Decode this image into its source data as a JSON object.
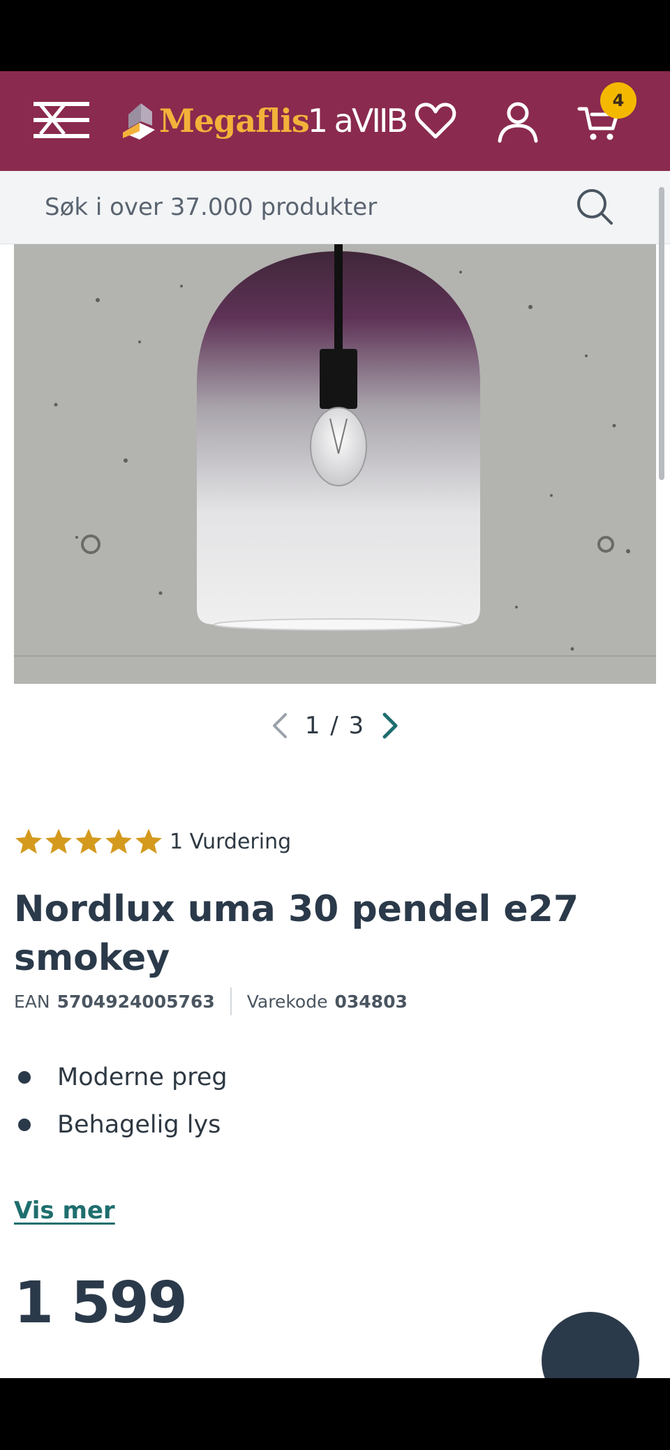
{
  "header": {
    "logo_text": "Megaflis",
    "logo_suffix": "1 aVIIB",
    "cart_count": "4"
  },
  "search": {
    "placeholder": "Søk i over 37.000 produkter"
  },
  "gallery": {
    "pager_text": "1 / 3"
  },
  "product": {
    "rating_text": "1 Vurdering",
    "stars": 5,
    "title": "Nordlux uma 30 pendel e27 smokey",
    "ean_label": "EAN",
    "ean_value": "5704924005763",
    "code_label": "Varekode",
    "code_value": "034803",
    "bullets": [
      "Moderne preg",
      "Behagelig lys"
    ],
    "more_link": "Vis mer",
    "price": "1 599"
  },
  "colors": {
    "header_bg": "#8a2a4e",
    "accent": "#f3b23a",
    "badge": "#f5b800",
    "link": "#1f6e6e"
  }
}
